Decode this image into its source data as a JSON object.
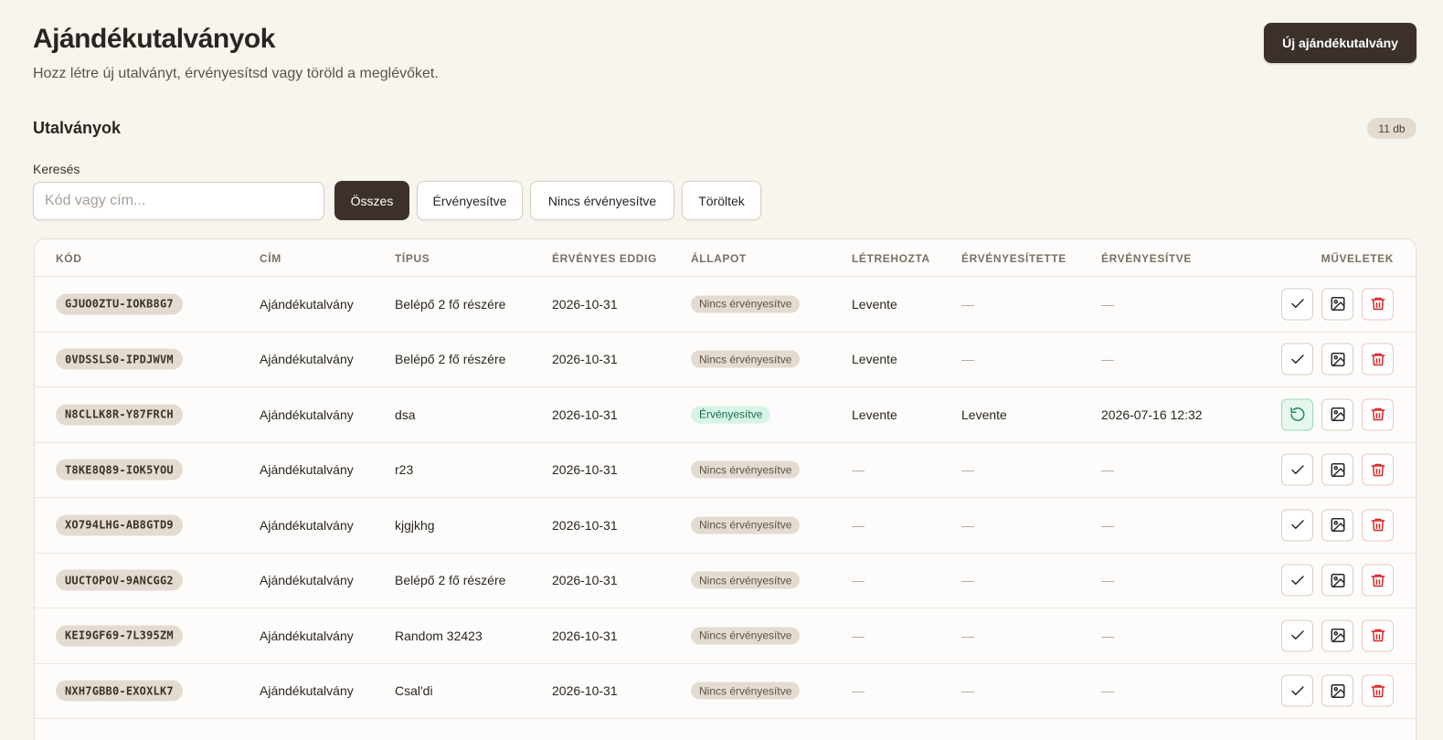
{
  "header": {
    "title": "Ajándékutalványok",
    "subtitle": "Hozz létre új utalványt, érvényesítsd vagy töröld a meglévőket.",
    "new_button": "Új ajándékutalvány"
  },
  "section": {
    "title": "Utalványok",
    "count": "11 db"
  },
  "search": {
    "label": "Keresés",
    "placeholder": "Kód vagy cím..."
  },
  "filters": [
    "Összes",
    "Érvényesítve",
    "Nincs érvényesítve",
    "Töröltek"
  ],
  "active_filter": "Összes",
  "table": {
    "columns": [
      "KÓD",
      "CÍM",
      "TÍPUS",
      "ÉRVÉNYES EDDIG",
      "ÁLLAPOT",
      "LÉTREHOZTA",
      "ÉRVÉNYESÍTETTE",
      "ÉRVÉNYESÍTVE",
      "MŰVELETEK"
    ],
    "rows": [
      {
        "code": "GJUO0ZTU-IOKB8G7",
        "title": "Ajándékutalvány",
        "type": "Belépő 2 fő részére",
        "valid_until": "2026-10-31",
        "status": "Nincs érvényesítve",
        "validated": false,
        "created_by": "Levente",
        "validated_by": "—",
        "validated_at": "—"
      },
      {
        "code": "0VDSSLS0-IPDJWVM",
        "title": "Ajándékutalvány",
        "type": "Belépő 2 fő részére",
        "valid_until": "2026-10-31",
        "status": "Nincs érvényesítve",
        "validated": false,
        "created_by": "Levente",
        "validated_by": "—",
        "validated_at": "—"
      },
      {
        "code": "N8CLLK8R-Y87FRCH",
        "title": "Ajándékutalvány",
        "type": "dsa",
        "valid_until": "2026-10-31",
        "status": "Érvényesítve",
        "validated": true,
        "created_by": "Levente",
        "validated_by": "Levente",
        "validated_at": "2026-07-16 12:32"
      },
      {
        "code": "T8KE8Q89-IOK5YOU",
        "title": "Ajándékutalvány",
        "type": "r23",
        "valid_until": "2026-10-31",
        "status": "Nincs érvényesítve",
        "validated": false,
        "created_by": "—",
        "validated_by": "—",
        "validated_at": "—"
      },
      {
        "code": "XO794LHG-AB8GTD9",
        "title": "Ajándékutalvány",
        "type": "kjgjkhg",
        "valid_until": "2026-10-31",
        "status": "Nincs érvényesítve",
        "validated": false,
        "created_by": "—",
        "validated_by": "—",
        "validated_at": "—"
      },
      {
        "code": "UUCTOPOV-9ANCGG2",
        "title": "Ajándékutalvány",
        "type": "Belépő 2 fő részére",
        "valid_until": "2026-10-31",
        "status": "Nincs érvényesítve",
        "validated": false,
        "created_by": "—",
        "validated_by": "—",
        "validated_at": "—"
      },
      {
        "code": "KEI9GF69-7L395ZM",
        "title": "Ajándékutalvány",
        "type": "Random 32423",
        "valid_until": "2026-10-31",
        "status": "Nincs érvényesítve",
        "validated": false,
        "created_by": "—",
        "validated_by": "—",
        "validated_at": "—"
      },
      {
        "code": "NXH7GBB0-EXOXLK7",
        "title": "Ajándékutalvány",
        "type": "Csal'di",
        "valid_until": "2026-10-31",
        "status": "Nincs érvényesítve",
        "validated": false,
        "created_by": "—",
        "validated_by": "—",
        "validated_at": "—"
      }
    ]
  },
  "colors": {
    "primary": "#3b312a",
    "background": "#f8f5ef",
    "pill": "#e4dbd0",
    "success_bg": "#d6f5e6",
    "success_text": "#1d6b47",
    "danger": "#dc2626"
  },
  "icons": {
    "validate": "check-icon",
    "unvalidate": "rotate-ccw-icon",
    "image": "image-icon",
    "delete": "trash-icon"
  }
}
